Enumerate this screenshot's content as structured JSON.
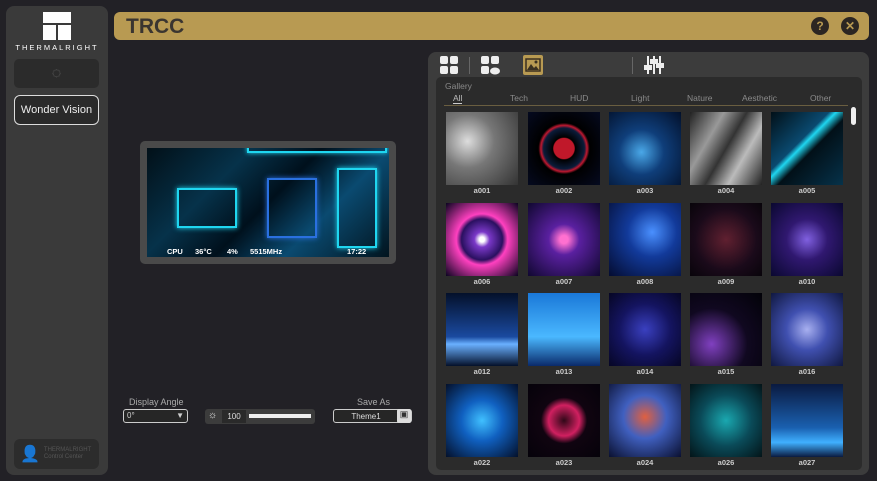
{
  "sidebar": {
    "brand": "THERMALRIGHT",
    "nav": [
      {
        "label": "",
        "icon": "gauge-icon"
      },
      {
        "label": "Wonder Vision"
      }
    ],
    "footer_line1": "THERMALRIGHT",
    "footer_line2": "Control Center"
  },
  "header": {
    "title": "TRCC",
    "help_label": "?",
    "close_label": "✕"
  },
  "preview": {
    "cpu_label": "CPU",
    "temp": "36°C",
    "usage": "4%",
    "freq": "5515MHz",
    "time": "17:22"
  },
  "controls": {
    "display_angle_label": "Display Angle",
    "display_angle_value": "0°",
    "brightness_value": "100",
    "brightness_fraction": 1.0,
    "save_as_label": "Save As",
    "save_as_value": "Theme1"
  },
  "panel": {
    "tools": [
      "grid-icon",
      "cloud-grid-icon",
      "gallery-image-icon",
      "sliders-icon"
    ],
    "active_tool": "gallery-image-icon",
    "accent": "#b89a52",
    "gallery_label": "Gallery",
    "categories": [
      "All",
      "Tech",
      "HUD",
      "Light",
      "Nature",
      "Aesthetic",
      "Other"
    ],
    "active_category": "All",
    "items": [
      {
        "label": "a001",
        "bg": "radial-gradient(circle at 30% 40%,#ddd,#777 40%,#333)"
      },
      {
        "label": "a002",
        "bg": "radial-gradient(circle,#c0182a 0 20%,#000 22%,#0b1c3a 40%,#c01830 45%,#000 50%,#050a20)"
      },
      {
        "label": "a003",
        "bg": "radial-gradient(circle at 45% 55%,#4aa8e8,#0f3e7a 40%,#02102a)"
      },
      {
        "label": "a004",
        "bg": "linear-gradient(120deg,#222,#999 30%,#333 50%,#bbb 70%,#222)"
      },
      {
        "label": "a005",
        "bg": "linear-gradient(135deg,#021018,#0a4a70 40%,#1fd6f0 45%,#021018 55%,#06324a)"
      },
      {
        "label": "a006",
        "bg": "radial-gradient(circle,#fff 0 5%,#7a38c8 15%,#2a1060 40%,#ff40c0 50%,#0a0420)"
      },
      {
        "label": "a007",
        "bg": "radial-gradient(circle,#ff70d0 0 8%,#5a20a0 30%,#100830)"
      },
      {
        "label": "a008",
        "bg": "radial-gradient(circle at 60% 40%,#4a90ff,#123a9a 40%,#040c30)"
      },
      {
        "label": "a009",
        "bg": "radial-gradient(circle,#602030,#1a0a1a 60%,#08040a)"
      },
      {
        "label": "a010",
        "bg": "radial-gradient(circle,#8060e0,#301870 40%,#0a0830)"
      },
      {
        "label": "a012",
        "bg": "linear-gradient(180deg,#04102a,#1a4aa0 60%,#6ab0ff 70%,#04102a)"
      },
      {
        "label": "a013",
        "bg": "linear-gradient(180deg,#1a78d8,#4ab8ff 60%,#0a2a6a)"
      },
      {
        "label": "a014",
        "bg": "radial-gradient(circle,#3a40c0,#141460 50%,#060624)"
      },
      {
        "label": "a015",
        "bg": "radial-gradient(circle at 30% 70%,#8040c0,#100820 50%,#020208)"
      },
      {
        "label": "a016",
        "bg": "radial-gradient(circle,#a8b0f0,#4050b0 40%,#101840)"
      },
      {
        "label": "a022",
        "bg": "radial-gradient(circle,#40c0ff,#1060c0 40%,#04102a)"
      },
      {
        "label": "a023",
        "bg": "radial-gradient(circle,#300818,#d02060 30%,#100410 45%,#05020a)"
      },
      {
        "label": "a024",
        "bg": "radial-gradient(circle at 50% 45%,#e06040,#4060c0 40%,#0a1030)"
      },
      {
        "label": "a026",
        "bg": "radial-gradient(circle,#1aa8b0,#0a4a58 50%,#031418)"
      },
      {
        "label": "a027",
        "bg": "linear-gradient(180deg,#0a1a40,#1a60b0 60%,#40b0ff 80%,#0a1a40)"
      }
    ]
  }
}
